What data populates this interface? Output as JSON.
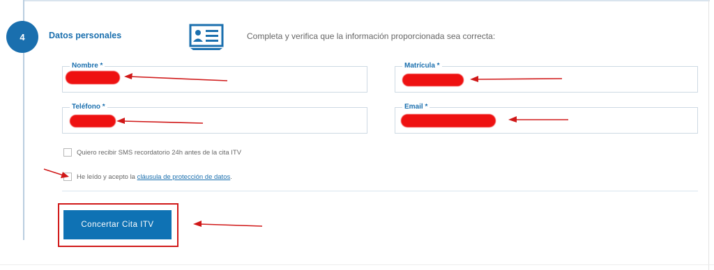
{
  "step": {
    "number": "4",
    "title": "Datos personales",
    "instructions": "Completa y verifica que la información proporcionada sea correcta:",
    "icon": "id-card-icon"
  },
  "fields": {
    "nombre": {
      "label": "Nombre *",
      "value": ""
    },
    "matricula": {
      "label": "Matrícula *",
      "value": ""
    },
    "telefono": {
      "label": "Teléfono *",
      "value": ""
    },
    "email": {
      "label": "Email *",
      "value": ""
    }
  },
  "checkboxes": {
    "sms": {
      "label": "Quiero recibir SMS recordatorio 24h antes de la cita ITV",
      "checked": false
    },
    "privacy": {
      "label_prefix": "He leído y acepto la ",
      "link_text": "cláusula de protección de datos",
      "label_suffix": ".",
      "checked": false
    }
  },
  "submit": {
    "label": "Concertar Cita ITV"
  },
  "colors": {
    "accent": "#1a6fae",
    "button": "#0f72b4",
    "annotation": "#d01818"
  }
}
